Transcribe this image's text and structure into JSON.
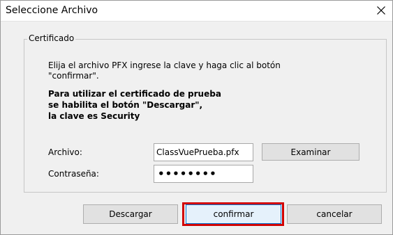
{
  "window": {
    "title": "Seleccione Archivo",
    "close_icon": "close-icon"
  },
  "group": {
    "label": "Certificado",
    "instructions_line1": "Elija el archivo PFX ingrese la clave y haga clic al botón",
    "instructions_line2": "\"confirmar\".",
    "note_line1": "Para utilizar el certificado de prueba",
    "note_line2": "se habilita el botón \"Descargar\",",
    "note_line3": "la clave es Security"
  },
  "form": {
    "file_label": "Archivo:",
    "file_value": "ClassVuePrueba.pfx",
    "browse_label": "Examinar",
    "password_label": "Contraseña:",
    "password_value": "••••••••"
  },
  "buttons": {
    "download_label": "Descargar",
    "confirm_label": "confirmar",
    "cancel_label": "cancelar"
  },
  "colors": {
    "highlight": "#d10000",
    "focus": "#0078d7"
  }
}
